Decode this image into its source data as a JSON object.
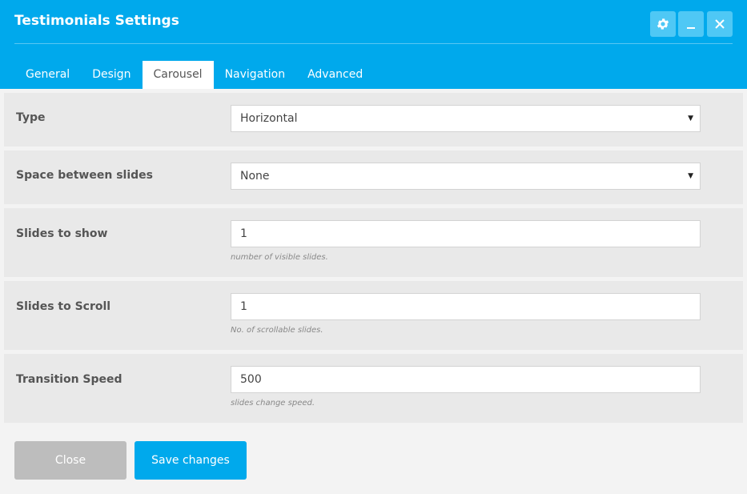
{
  "dialog": {
    "title": "Testimonials Settings",
    "header_buttons": [
      "gear-icon",
      "minimize-icon",
      "close-icon"
    ]
  },
  "tabs": [
    {
      "label": "General"
    },
    {
      "label": "Design"
    },
    {
      "label": "Carousel",
      "active": true
    },
    {
      "label": "Navigation"
    },
    {
      "label": "Advanced"
    }
  ],
  "fields": {
    "type": {
      "label": "Type",
      "value": "Horizontal"
    },
    "space": {
      "label": "Space between slides",
      "value": "None"
    },
    "slides_show": {
      "label": "Slides to show",
      "value": "1",
      "help": "number of visible slides."
    },
    "slides_scroll": {
      "label": "Slides to Scroll",
      "value": "1",
      "help": "No. of scrollable slides."
    },
    "speed": {
      "label": "Transition Speed",
      "value": "500",
      "help": "slides change speed."
    }
  },
  "footer": {
    "close_label": "Close",
    "save_label": "Save changes"
  },
  "colors": {
    "accent": "#00a9ec",
    "header_button": "#4fc8f5",
    "close_button": "#bdbdbd"
  }
}
